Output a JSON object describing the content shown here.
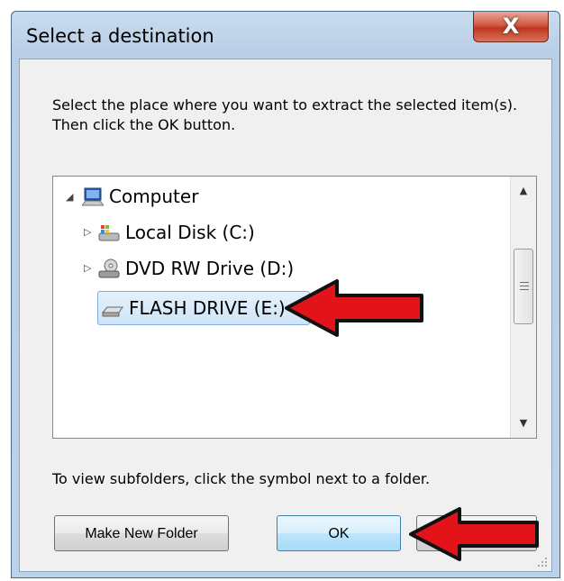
{
  "window": {
    "title": "Select a destination",
    "close_label": "X"
  },
  "instructions": "Select the place where you want to extract the selected item(s).  Then click the OK button.",
  "tree": {
    "items": [
      {
        "label": "Computer",
        "icon": "computer-icon",
        "expanded": true
      },
      {
        "label": "Local Disk (C:)",
        "icon": "local-disk-icon",
        "expanded": false
      },
      {
        "label": "DVD RW Drive (D:)",
        "icon": "dvd-drive-icon",
        "expanded": false
      },
      {
        "label": "FLASH DRIVE (E:)",
        "icon": "flash-drive-icon",
        "selected": true
      }
    ]
  },
  "footer_text": "To view subfolders, click the symbol next to a folder.",
  "buttons": {
    "make_new_folder": "Make New Folder",
    "ok": "OK",
    "cancel": "Cancel"
  },
  "colors": {
    "selection": "#cee4f7",
    "annotation_arrow": "#e3131a"
  }
}
